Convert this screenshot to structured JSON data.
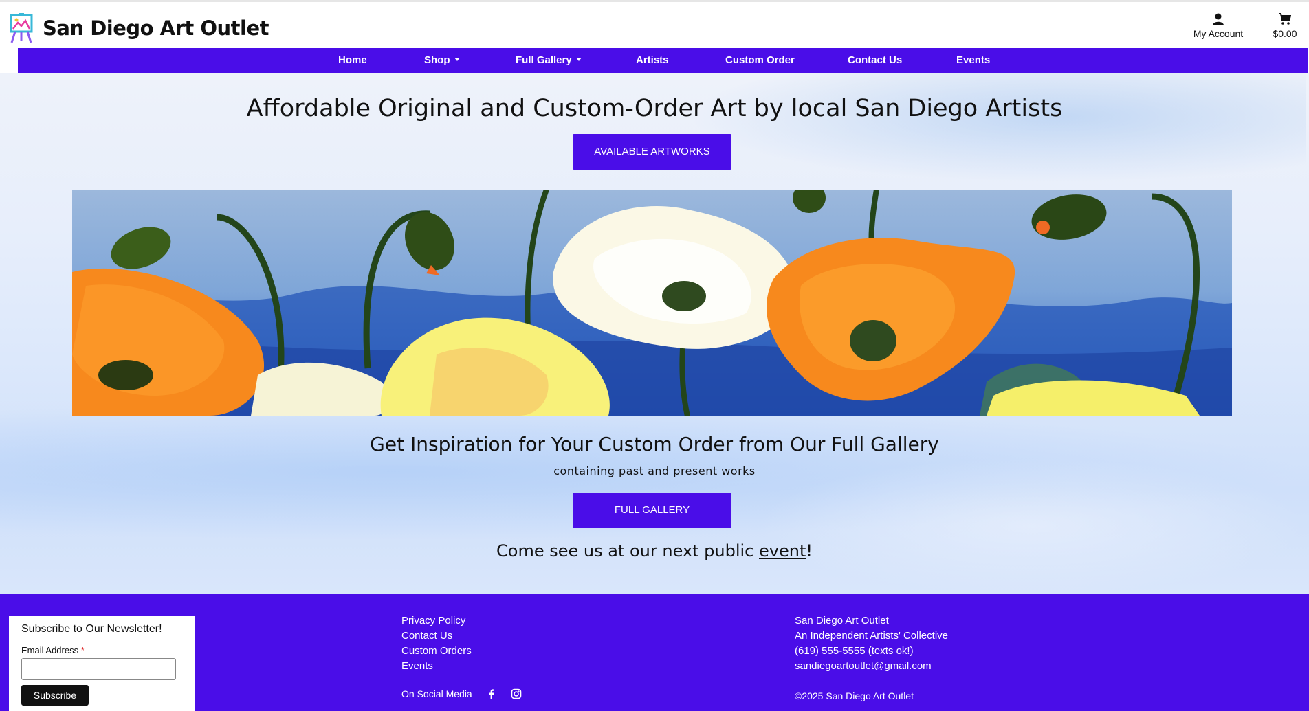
{
  "header": {
    "site_title": "San Diego Art Outlet",
    "account_label": "My Account",
    "cart_total": "$0.00"
  },
  "nav": {
    "items": [
      {
        "label": "Home",
        "dropdown": false
      },
      {
        "label": "Shop",
        "dropdown": true
      },
      {
        "label": "Full Gallery",
        "dropdown": true
      },
      {
        "label": "Artists",
        "dropdown": false
      },
      {
        "label": "Custom Order",
        "dropdown": false
      },
      {
        "label": "Contact Us",
        "dropdown": false
      },
      {
        "label": "Events",
        "dropdown": false
      }
    ]
  },
  "hero": {
    "headline": "Affordable Original and Custom-Order Art by local San Diego Artists",
    "artworks_button": "AVAILABLE ARTWORKS",
    "gallery_heading": "Get Inspiration for Your Custom Order from Our Full Gallery",
    "gallery_sub": "containing past and present works",
    "gallery_button": "FULL GALLERY",
    "event_prefix": "Come see us at our next public ",
    "event_link": "event",
    "event_suffix": "!"
  },
  "footer": {
    "newsletter": {
      "title": "Subscribe to Our Newsletter!",
      "email_label": "Email Address",
      "required_mark": "*",
      "email_value": "",
      "subscribe_button": "Subscribe"
    },
    "links": [
      "Privacy Policy",
      "Contact Us",
      "Custom Orders",
      "Events"
    ],
    "social_label": "On Social Media",
    "social_icons": [
      "facebook-icon",
      "instagram-icon"
    ],
    "info": {
      "name": "San Diego Art Outlet",
      "tagline": "An Independent Artists' Collective",
      "phone": "(619) 555-5555 (texts ok!)",
      "email": "sandiegoartoutlet@gmail.com"
    },
    "copyright": "©2025 San Diego Art Outlet"
  },
  "colors": {
    "brand_purple": "#4a0de8",
    "button_dark": "#111111"
  }
}
